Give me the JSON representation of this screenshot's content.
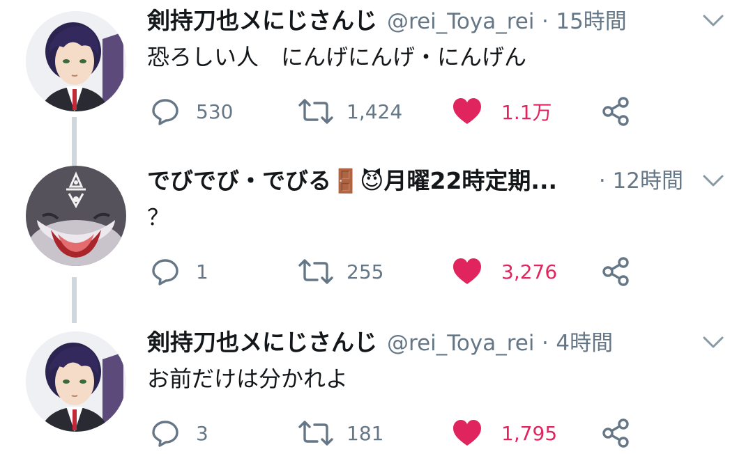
{
  "tweets": [
    {
      "name": "剣持刀也〤にじさんじ",
      "handle": "@rei_Toya_rei",
      "separator": "·",
      "time": "15時間",
      "text": "恐ろしい人　にんげにんげ・にんげん",
      "replies": "530",
      "retweets": "1,424",
      "likes": "1.1万",
      "liked": true
    },
    {
      "name": "でびでび・でびる🚪😈月曜22時定期...",
      "handle": "",
      "separator": "·",
      "time": "12時間",
      "text": "？",
      "replies": "1",
      "retweets": "255",
      "likes": "3,276",
      "liked": true
    },
    {
      "name": "剣持刀也〤にじさんじ",
      "handle": "@rei_Toya_rei",
      "separator": "·",
      "time": "4時間",
      "text": "お前だけは分かれよ",
      "replies": "3",
      "retweets": "181",
      "likes": "1,795",
      "liked": true
    }
  ],
  "colors": {
    "like": "#e0245e",
    "muted": "#657786",
    "thread_line": "#cfd6dc"
  },
  "icons": [
    "reply-icon",
    "retweet-icon",
    "heart-icon",
    "share-icon",
    "chevron-down-icon"
  ]
}
